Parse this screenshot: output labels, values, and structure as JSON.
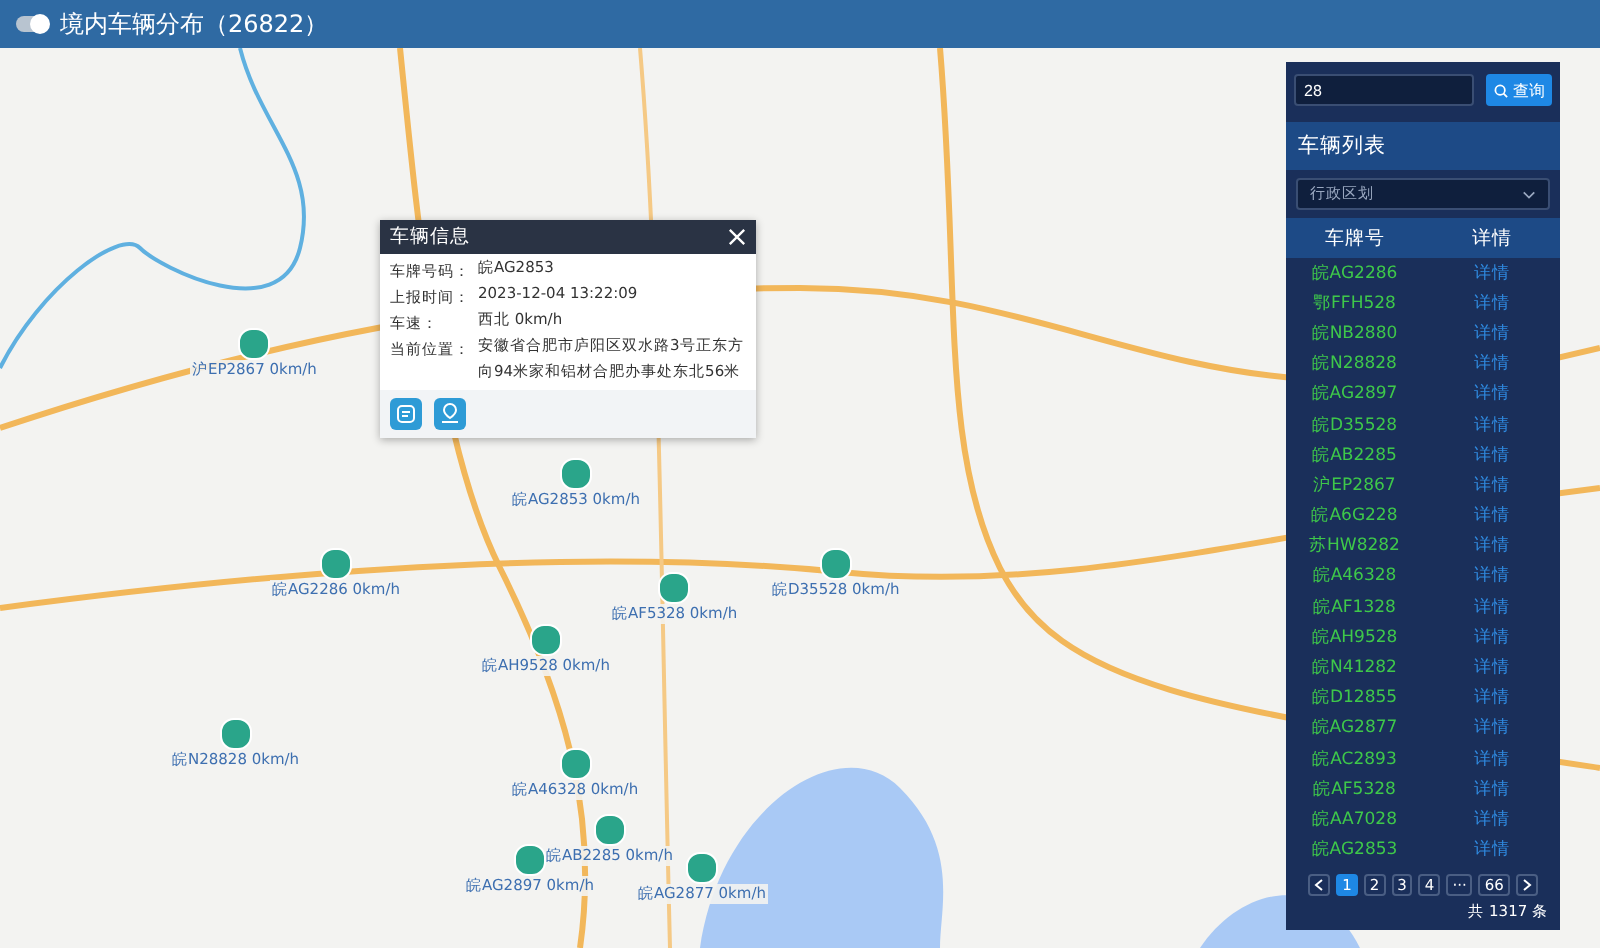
{
  "header": {
    "title": "境内车辆分布（26822）",
    "toggle_on": true
  },
  "map": {
    "vehicles": [
      {
        "label": "沪EP2867 0km/h"
      },
      {
        "label": "皖AG2853 0km/h"
      },
      {
        "label": "皖AG2286 0km/h"
      },
      {
        "label": "皖AF5328 0km/h"
      },
      {
        "label": "皖D35528 0km/h"
      },
      {
        "label": "皖AH9528 0km/h"
      },
      {
        "label": "皖N28828 0km/h"
      },
      {
        "label": "皖A46328 0km/h"
      },
      {
        "label": "皖AB2285 0km/h"
      },
      {
        "label": "皖AG2897 0km/h"
      },
      {
        "label": "皖AG2877 0km/h"
      }
    ]
  },
  "popup": {
    "title": "车辆信息",
    "fields": [
      {
        "label": "车牌号码：",
        "value": "皖AG2853"
      },
      {
        "label": "上报时间：",
        "value": "2023-12-04 13:22:09"
      },
      {
        "label": "车速：",
        "value": "西北 0km/h"
      },
      {
        "label": "当前位置：",
        "value": "安徽省合肥市庐阳区双水路3号正东方向94米家和铝材合肥办事处东北56米"
      }
    ]
  },
  "panel": {
    "search": {
      "value": "28"
    },
    "search_button": "查询",
    "title": "车辆列表",
    "region_select": {
      "placeholder": "行政区划"
    },
    "columns": [
      "车牌号",
      "详情"
    ],
    "rows": [
      {
        "plate": "皖AG2286",
        "action": "详情"
      },
      {
        "plate": "鄂FFH528",
        "action": "详情"
      },
      {
        "plate": "皖NB2880",
        "action": "详情"
      },
      {
        "plate": "皖N28828",
        "action": "详情"
      },
      {
        "plate": "皖AG2897",
        "action": "详情"
      },
      {
        "plate": "皖D35528",
        "action": "详情"
      },
      {
        "plate": "皖AB2285",
        "action": "详情"
      },
      {
        "plate": "沪EP2867",
        "action": "详情"
      },
      {
        "plate": "皖A6G228",
        "action": "详情"
      },
      {
        "plate": "苏HW8282",
        "action": "详情"
      },
      {
        "plate": "皖A46328",
        "action": "详情"
      },
      {
        "plate": "皖AF1328",
        "action": "详情"
      },
      {
        "plate": "皖AH9528",
        "action": "详情"
      },
      {
        "plate": "皖N41282",
        "action": "详情"
      },
      {
        "plate": "皖D12855",
        "action": "详情"
      },
      {
        "plate": "皖AG2877",
        "action": "详情"
      },
      {
        "plate": "皖AC2893",
        "action": "详情"
      },
      {
        "plate": "皖AF5328",
        "action": "详情"
      },
      {
        "plate": "皖AA7028",
        "action": "详情"
      },
      {
        "plate": "皖AG2853",
        "action": "详情"
      }
    ],
    "pagination": {
      "pages": [
        {
          "label": "1",
          "selected": true
        },
        {
          "label": "2",
          "selected": false
        },
        {
          "label": "3",
          "selected": false
        },
        {
          "label": "4",
          "selected": false
        },
        {
          "label": "···",
          "selected": false
        },
        {
          "label": "66",
          "selected": false
        }
      ],
      "total": "共 1317 条"
    }
  }
}
